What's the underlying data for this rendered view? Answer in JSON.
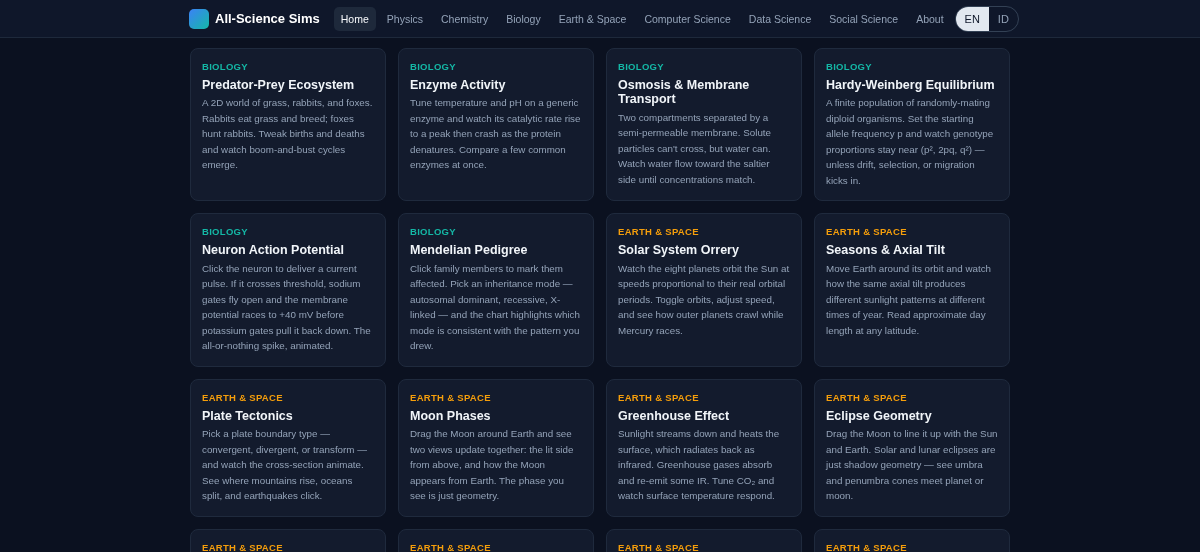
{
  "brand": {
    "title": "All-Science Sims"
  },
  "nav": [
    {
      "label": "Home",
      "selected": true
    },
    {
      "label": "Physics",
      "selected": false
    },
    {
      "label": "Chemistry",
      "selected": false
    },
    {
      "label": "Biology",
      "selected": false
    },
    {
      "label": "Earth & Space",
      "selected": false
    },
    {
      "label": "Computer Science",
      "selected": false
    },
    {
      "label": "Data Science",
      "selected": false
    },
    {
      "label": "Social Science",
      "selected": false
    },
    {
      "label": "About",
      "selected": false
    }
  ],
  "languages": [
    {
      "label": "EN",
      "selected": true
    },
    {
      "label": "ID",
      "selected": false
    }
  ],
  "cards": [
    {
      "category": "BIOLOGY",
      "color": "#14b8a6",
      "title": "Predator-Prey Ecosystem",
      "description": "A 2D world of grass, rabbits, and foxes. Rabbits eat grass and breed; foxes hunt rabbits. Tweak births and deaths and watch boom-and-bust cycles emerge."
    },
    {
      "category": "BIOLOGY",
      "color": "#14b8a6",
      "title": "Enzyme Activity",
      "description": "Tune temperature and pH on a generic enzyme and watch its catalytic rate rise to a peak then crash as the protein denatures. Compare a few common enzymes at once."
    },
    {
      "category": "BIOLOGY",
      "color": "#14b8a6",
      "title": "Osmosis & Membrane Transport",
      "description": "Two compartments separated by a semi-permeable membrane. Solute particles can't cross, but water can. Watch water flow toward the saltier side until concentrations match."
    },
    {
      "category": "BIOLOGY",
      "color": "#14b8a6",
      "title": "Hardy-Weinberg Equilibrium",
      "description": "A finite population of randomly-mating diploid organisms. Set the starting allele frequency p and watch genotype proportions stay near (p², 2pq, q²) — unless drift, selection, or migration kicks in."
    },
    {
      "category": "BIOLOGY",
      "color": "#14b8a6",
      "title": "Neuron Action Potential",
      "description": "Click the neuron to deliver a current pulse. If it crosses threshold, sodium gates fly open and the membrane potential races to +40 mV before potassium gates pull it back down. The all-or-nothing spike, animated."
    },
    {
      "category": "BIOLOGY",
      "color": "#14b8a6",
      "title": "Mendelian Pedigree",
      "description": "Click family members to mark them affected. Pick an inheritance mode — autosomal dominant, recessive, X-linked — and the chart highlights which mode is consistent with the pattern you drew."
    },
    {
      "category": "EARTH & SPACE",
      "color": "#f59e0b",
      "title": "Solar System Orrery",
      "description": "Watch the eight planets orbit the Sun at speeds proportional to their real orbital periods. Toggle orbits, adjust speed, and see how outer planets crawl while Mercury races."
    },
    {
      "category": "EARTH & SPACE",
      "color": "#f59e0b",
      "title": "Seasons & Axial Tilt",
      "description": "Move Earth around its orbit and watch how the same axial tilt produces different sunlight patterns at different times of year. Read approximate day length at any latitude."
    },
    {
      "category": "EARTH & SPACE",
      "color": "#f59e0b",
      "title": "Plate Tectonics",
      "description": "Pick a plate boundary type — convergent, divergent, or transform — and watch the cross-section animate. See where mountains rise, oceans split, and earthquakes click."
    },
    {
      "category": "EARTH & SPACE",
      "color": "#f59e0b",
      "title": "Moon Phases",
      "description": "Drag the Moon around Earth and see two views update together: the lit side from above, and how the Moon appears from Earth. The phase you see is just geometry."
    },
    {
      "category": "EARTH & SPACE",
      "color": "#f59e0b",
      "title": "Greenhouse Effect",
      "description": "Sunlight streams down and heats the surface, which radiates back as infrared. Greenhouse gases absorb and re-emit some IR. Tune CO₂ and watch surface temperature respond."
    },
    {
      "category": "EARTH & SPACE",
      "color": "#f59e0b",
      "title": "Eclipse Geometry",
      "description": "Drag the Moon to line it up with the Sun and Earth. Solar and lunar eclipses are just shadow geometry — see umbra and penumbra cones meet planet or moon."
    },
    {
      "category": "EARTH & SPACE",
      "color": "#f59e0b"
    },
    {
      "category": "EARTH & SPACE",
      "color": "#f59e0b"
    },
    {
      "category": "EARTH & SPACE",
      "color": "#f59e0b"
    },
    {
      "category": "EARTH & SPACE",
      "color": "#f59e0b"
    }
  ]
}
